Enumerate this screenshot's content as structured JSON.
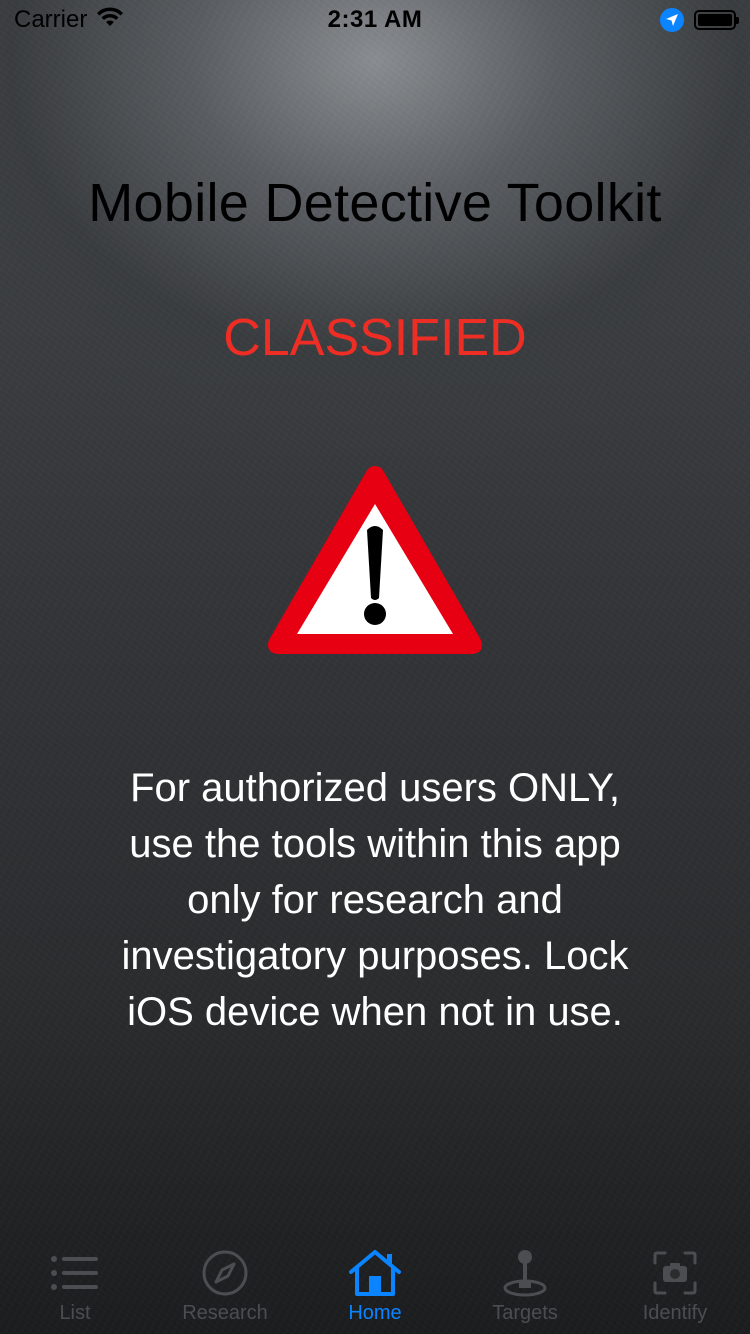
{
  "status_bar": {
    "carrier": "Carrier",
    "time": "2:31 AM"
  },
  "main": {
    "title": "Mobile Detective Toolkit",
    "classified_label": "CLASSIFIED",
    "classified_color": "#ee2e24",
    "warning_icon": "warning-triangle-icon",
    "notice_text": "For authorized users ONLY, use the tools within this app only for research and investigatory purposes. Lock iOS device when not in use."
  },
  "tab_bar": {
    "active_color": "#0a84ff",
    "tabs": [
      {
        "label": "List",
        "icon": "list-icon",
        "active": false
      },
      {
        "label": "Research",
        "icon": "compass-icon",
        "active": false
      },
      {
        "label": "Home",
        "icon": "home-icon",
        "active": true
      },
      {
        "label": "Targets",
        "icon": "joystick-icon",
        "active": false
      },
      {
        "label": "Identify",
        "icon": "camera-scan-icon",
        "active": false
      }
    ]
  }
}
